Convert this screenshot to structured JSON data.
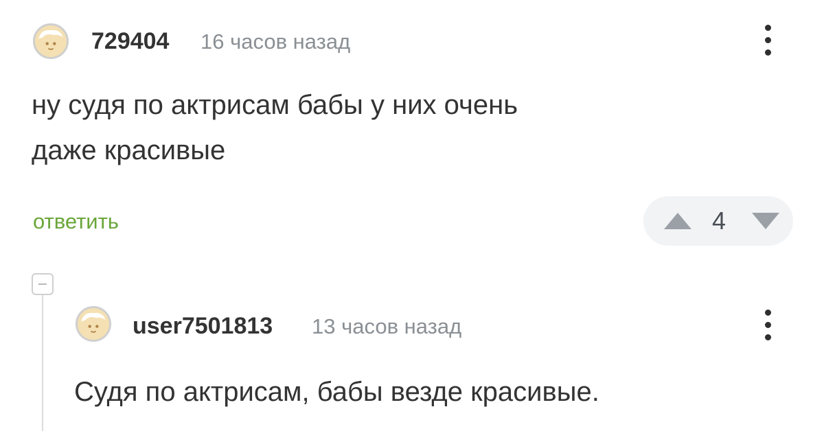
{
  "comments": [
    {
      "username": "729404",
      "time": "16 часов назад",
      "text_lines": [
        "ну судя по актрисам бабы у них очень",
        "даже красивые"
      ],
      "reply_label": "ответить",
      "rating": "4"
    },
    {
      "username": "user7501813",
      "time": "13 часов назад",
      "text_lines": [
        "Судя по актрисам, бабы везде красивые."
      ]
    }
  ],
  "icons": {
    "avatar": "default-avatar-icon",
    "more": "more-vertical-icon",
    "upvote": "upvote-triangle-icon",
    "downvote": "downvote-triangle-icon",
    "collapse": "collapse-thread-icon"
  },
  "colors": {
    "reply_link": "#6aa63a",
    "vote_bg": "#f1f3f5",
    "vote_arrow": "#9aa0a6",
    "username": "#333333",
    "timestamp": "#8a8f94"
  }
}
